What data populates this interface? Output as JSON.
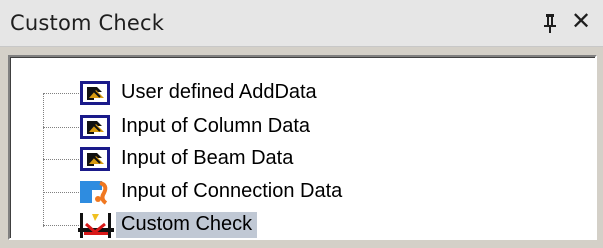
{
  "window": {
    "title": "Custom Check",
    "pin_icon": "pin-icon",
    "close_label": "✕"
  },
  "tree": {
    "items": [
      {
        "label": "User defined AddData",
        "icon": "input-data-icon",
        "selected": false
      },
      {
        "label": "Input of Column Data",
        "icon": "input-data-icon",
        "selected": false
      },
      {
        "label": "Input of Beam Data",
        "icon": "input-data-icon",
        "selected": false
      },
      {
        "label": "Input of Connection Data",
        "icon": "connection-icon",
        "selected": false
      },
      {
        "label": "Custom Check",
        "icon": "custom-check-icon",
        "selected": true
      }
    ]
  },
  "colors": {
    "selection": "#c0c8d4",
    "titlebar": "#e6e6e6"
  }
}
